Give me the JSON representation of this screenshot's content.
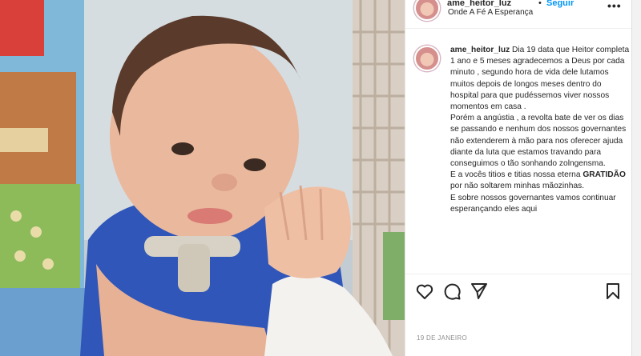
{
  "post": {
    "username": "ame_heitor_luz",
    "separator": "•",
    "follow_label": "Seguir",
    "location": "Onde A Fé A Esperança",
    "more_icon": "more-horizontal-icon",
    "date": "19 DE JANEIRO"
  },
  "caption": {
    "username": "ame_heitor_luz",
    "lines": [
      "Dia 19 data que Heitor completa 1 ano e 5 meses agradecemos a Deus por cada minuto , segundo hora de vida dele lutamos muitos depois de longos meses dentro do hospital para que pudéssemos viver nossos momentos em casa .",
      "Porém a angústia , a revolta bate de ver os dias se passando e nenhum dos nossos governantes não extenderem à mão para nos oferecer ajuda diante da luta que estamos travando para conseguimos o tão sonhando zolngensma.",
      "E a vocês titios e titias nossa eterna",
      "por não soltarem minhas mãozinhas.",
      "E sobre nossos governantes vamos continuar esperançando eles aqui"
    ],
    "gratitude": "GRATIDÃO"
  },
  "actions": {
    "like_icon": "heart-icon",
    "comment_icon": "comment-icon",
    "share_icon": "share-icon",
    "save_icon": "bookmark-icon"
  },
  "colors": {
    "follow": "#0095f6",
    "text": "#262626",
    "muted": "#8e8e8e"
  }
}
